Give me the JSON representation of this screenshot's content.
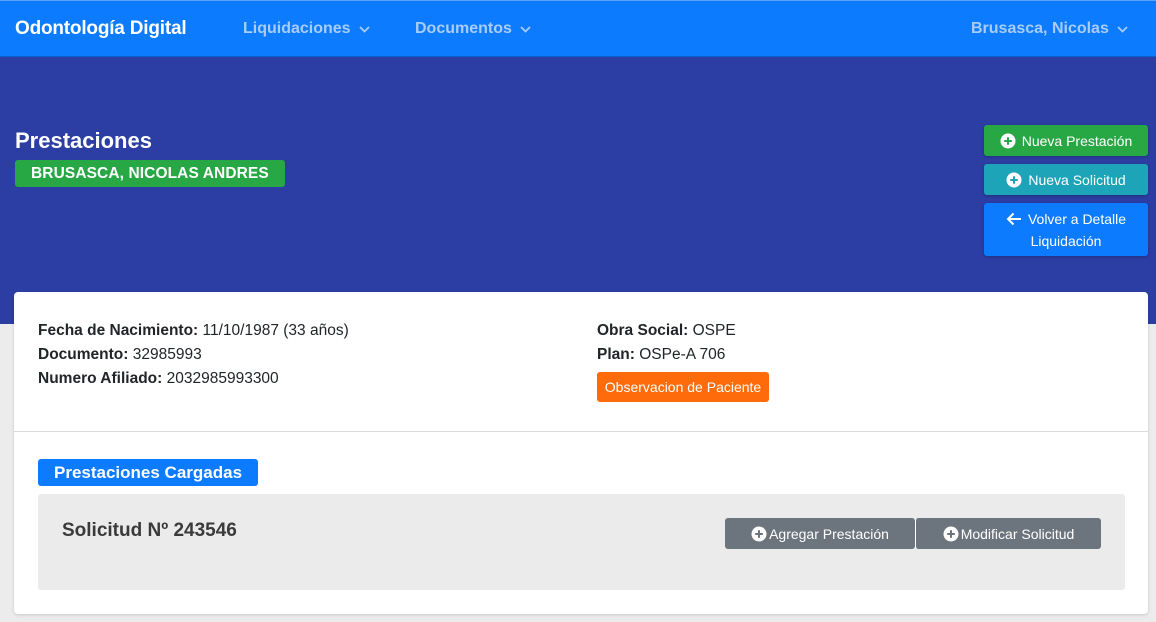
{
  "topnav": {
    "brand": "Odontología Digital",
    "menu_liquidaciones": "Liquidaciones",
    "menu_documentos": "Documentos",
    "user_menu": "Brusasca, Nicolas",
    "icon_dropdown": "chevron-down-icon"
  },
  "header": {
    "title": "Prestaciones",
    "patient_name": "BRUSASCA, NICOLAS ANDRES",
    "btn_nueva_prestacion": "Nueva Prestación",
    "btn_nueva_solicitud": "Nueva Solicitud",
    "btn_volver_line1": "Volver a Detalle",
    "btn_volver_line2": "Liquidación",
    "icon_add": "plus-circle-icon",
    "icon_back": "arrow-left-icon"
  },
  "patient": {
    "fecha_nacimiento_label": "Fecha de Nacimiento:",
    "fecha_nacimiento_value": "11/10/1987 (33 años)",
    "documento_label": "Documento:",
    "documento_value": "32985993",
    "afiliado_label": "Numero Afiliado:",
    "afiliado_value": "2032985993300",
    "obra_social_label": "Obra Social:",
    "obra_social_value": "OSPE",
    "plan_label": "Plan:",
    "plan_value": "OSPe-A 706",
    "btn_observacion": "Observacion de Paciente"
  },
  "prestaciones": {
    "section_title": "Prestaciones Cargadas",
    "solicitud_title": "Solicitud Nº 243546",
    "btn_agregar": "Agregar Prestación",
    "btn_modificar": "Modificar Solicitud"
  },
  "colors": {
    "navbar": "#0d7bfd",
    "header_bg": "#2c3ea4",
    "success": "#28a745",
    "info": "#1ea4b8",
    "warning": "#fd6b0a",
    "secondary": "#6c757d"
  }
}
